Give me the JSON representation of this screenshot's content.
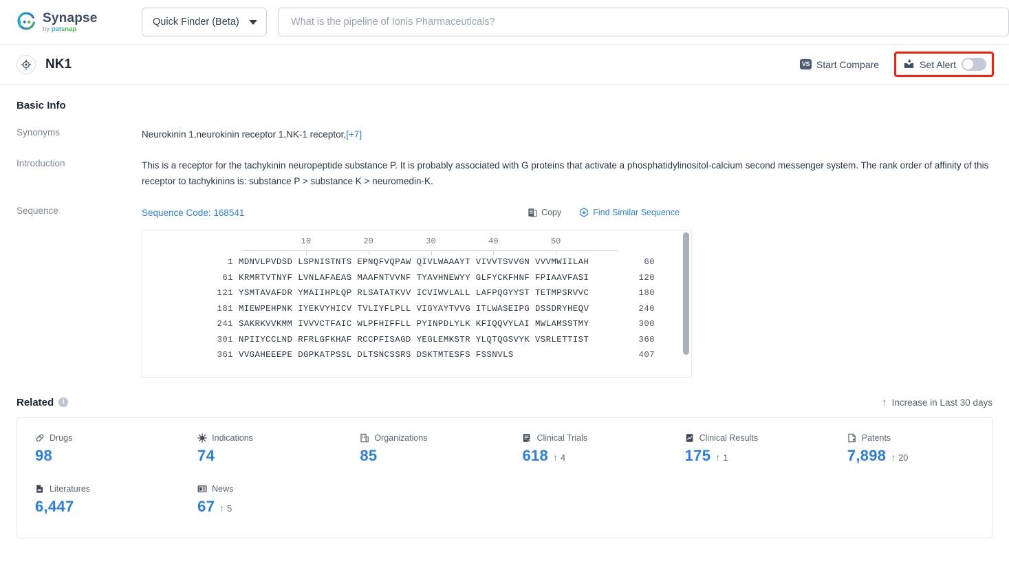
{
  "header": {
    "logo_title": "Synapse",
    "logo_sub_by": "by ",
    "logo_sub_pat": "pat",
    "logo_sub_snap": "snap",
    "finder_label": "Quick Finder (Beta)",
    "search_placeholder": "What is the pipeline of Ionis Pharmaceuticals?",
    "search_value": ""
  },
  "entity": {
    "name": "NK1",
    "start_compare": "Start Compare",
    "vs_badge": "VS",
    "set_alert": "Set Alert",
    "alert_toggle_state": "off",
    "highlight_color": "#fa1e0e"
  },
  "basic_info": {
    "section_title": "Basic Info",
    "synonyms_label": "Synonyms",
    "synonyms_value": "Neurokinin 1,neurokinin receptor 1,NK-1 receptor,",
    "synonyms_more": "[+7]",
    "introduction_label": "Introduction",
    "introduction_value": "This is a receptor for the tachykinin neuropeptide substance P. It is probably associated with G proteins that activate a phosphatidylinositol-calcium second messenger system. The rank order of affinity of this receptor to tachykinins is: substance P > substance K > neuromedin-K."
  },
  "sequence": {
    "label": "Sequence",
    "code_text": "Sequence Code: 168541",
    "copy_label": "Copy",
    "find_similar_label": "Find Similar Sequence",
    "ruler_ticks": [
      10,
      20,
      30,
      40,
      50
    ],
    "lines": [
      {
        "start": "1",
        "chunks": "MDNVLPVDSD LSPNISTNTS EPNQFVQPAW QIVLWAAAYT VIVVTSVVGN VVVMWIILAH",
        "end": "60"
      },
      {
        "start": "61",
        "chunks": "KRMRTVTNYF LVNLAFAEAS MAAFNTVVNF TYAVHNEWYY GLFYCKFHNF FPIAAVFASI",
        "end": "120"
      },
      {
        "start": "121",
        "chunks": "YSMTAVAFDR YMAIIHPLQP RLSATATKVV ICVIWVLALL LAFPQGYYST TETMPSRVVC",
        "end": "180"
      },
      {
        "start": "181",
        "chunks": "MIEWPEHPNK IYEKVYHICV TVLIYFLPLL VIGYAYTVVG ITLWASEIPG DSSDRYHEQV",
        "end": "240"
      },
      {
        "start": "241",
        "chunks": "SAKRKVVKMM IVVVCTFAIC WLPFHIFFLL PYINPDLYLK KFIQQVYLAI MWLAMSSTMY",
        "end": "300"
      },
      {
        "start": "301",
        "chunks": "NPIIYCCLND RFRLGFKHAF RCCPFISAGD YEGLEMKSTR YLQTQGSVYK VSRLETTIST",
        "end": "360"
      },
      {
        "start": "361",
        "chunks": "VVGAHEEEPE DGPKATPSSL DLTSNCSSRS DSKTMTESFS FSSNVLS",
        "end": "407"
      }
    ]
  },
  "related": {
    "title": "Related",
    "info_glyph": "i",
    "legend": "Increase in Last 30 days",
    "legend_arrow": "↑",
    "accent_color": "#2a7fe0",
    "increase_color": "#34a853",
    "items": [
      {
        "icon": "pill-icon",
        "label": "Drugs",
        "value": "98",
        "delta": ""
      },
      {
        "icon": "virus-icon",
        "label": "Indications",
        "value": "74",
        "delta": ""
      },
      {
        "icon": "building-icon",
        "label": "Organizations",
        "value": "85",
        "delta": ""
      },
      {
        "icon": "clinical-trial-icon",
        "label": "Clinical Trials",
        "value": "618",
        "delta": "4"
      },
      {
        "icon": "clinical-result-icon",
        "label": "Clinical Results",
        "value": "175",
        "delta": "1"
      },
      {
        "icon": "patent-icon",
        "label": "Patents",
        "value": "7,898",
        "delta": "20"
      },
      {
        "icon": "literature-icon",
        "label": "Literatures",
        "value": "6,447",
        "delta": ""
      },
      {
        "icon": "news-icon",
        "label": "News",
        "value": "67",
        "delta": "5"
      }
    ]
  }
}
